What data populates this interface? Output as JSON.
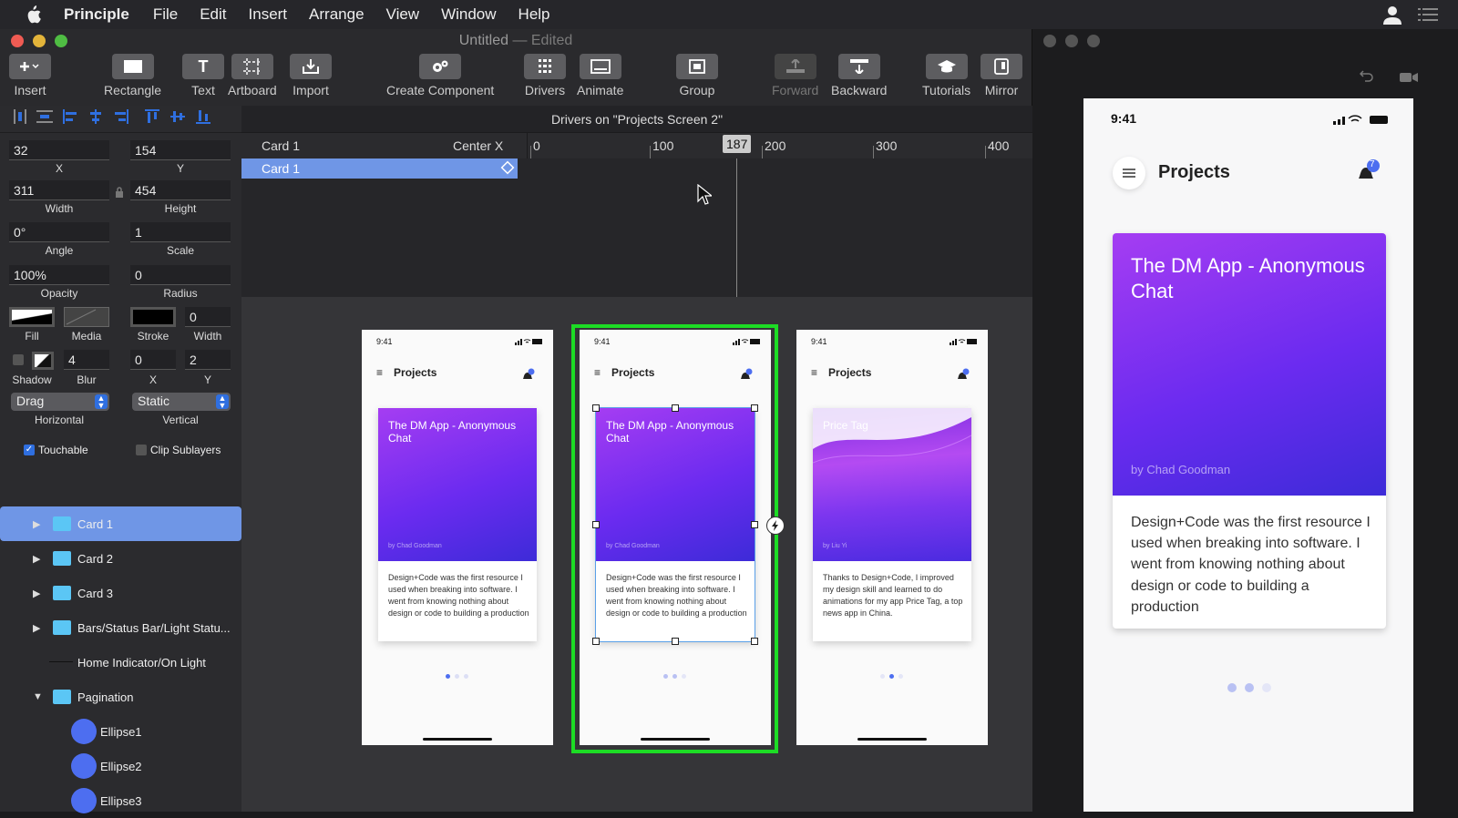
{
  "menubar": {
    "app": "Principle",
    "items": [
      "File",
      "Edit",
      "Insert",
      "Arrange",
      "View",
      "Window",
      "Help"
    ]
  },
  "window": {
    "title": "Untitled",
    "edited": "— Edited"
  },
  "toolbar": {
    "insert": "Insert",
    "rectangle": "Rectangle",
    "text": "Text",
    "artboard": "Artboard",
    "import": "Import",
    "create_component": "Create Component",
    "drivers": "Drivers",
    "animate": "Animate",
    "group": "Group",
    "forward": "Forward",
    "backward": "Backward",
    "tutorials": "Tutorials",
    "mirror": "Mirror"
  },
  "inspector": {
    "x": "32",
    "y": "154",
    "x_label": "X",
    "y_label": "Y",
    "width": "311",
    "height": "454",
    "width_label": "Width",
    "height_label": "Height",
    "angle": "0°",
    "scale": "1",
    "angle_label": "Angle",
    "scale_label": "Scale",
    "opacity": "100%",
    "radius": "0",
    "opacity_label": "Opacity",
    "radius_label": "Radius",
    "fill_label": "Fill",
    "media_label": "Media",
    "stroke_label": "Stroke",
    "stroke_width": "0",
    "stroke_width_label": "Width",
    "blur": "4",
    "shadow_x": "0",
    "shadow_y": "2",
    "shadow_label": "Shadow",
    "blur_label": "Blur",
    "sx_label": "X",
    "sy_label": "Y",
    "horizontal": "Drag",
    "vertical": "Static",
    "horizontal_label": "Horizontal",
    "vertical_label": "Vertical",
    "touchable": "Touchable",
    "clip": "Clip Sublayers"
  },
  "layers": [
    {
      "name": "Card 1",
      "type": "folder",
      "expanded": false,
      "selected": true
    },
    {
      "name": "Card 2",
      "type": "folder",
      "expanded": false
    },
    {
      "name": "Card 3",
      "type": "folder",
      "expanded": false
    },
    {
      "name": "Bars/Status Bar/Light Statu...",
      "type": "folder",
      "expanded": false
    },
    {
      "name": "Home Indicator/On Light",
      "type": "line"
    },
    {
      "name": "Pagination",
      "type": "folder",
      "expanded": true
    },
    {
      "name": "Ellipse1",
      "type": "ellipse"
    },
    {
      "name": "Ellipse2",
      "type": "ellipse"
    },
    {
      "name": "Ellipse3",
      "type": "ellipse"
    }
  ],
  "drivers": {
    "title": "Drivers on \"Projects Screen 2\"",
    "layer": "Card 1",
    "property": "Center X",
    "row": "Card 1",
    "current": "187",
    "ticks": [
      "0",
      "100",
      "200",
      "300",
      "400"
    ]
  },
  "screens": [
    {
      "time": "9:41",
      "header": "Projects",
      "card_title": "The DM App - Anonymous Chat",
      "by": "by Chad Goodman",
      "body": "Design+Code was the first resource I used when breaking into software. I went from knowing nothing about design or code to building a production"
    },
    {
      "time": "9:41",
      "header": "Projects",
      "card_title": "The DM App - Anonymous Chat",
      "by": "by Chad Goodman",
      "body": "Design+Code was the first resource I used when breaking into software. I went from knowing nothing about design or code to building a production"
    },
    {
      "time": "9:41",
      "header": "Projects",
      "card_title": "Price Tag",
      "by": "by Liu Yi",
      "body": "Thanks to Design+Code, I improved my design skill and learned to do animations for my app Price Tag, a top news app in China."
    }
  ],
  "preview": {
    "time": "9:41",
    "header": "Projects",
    "badge": "7",
    "card_title": "The DM App - Anonymous Chat",
    "by": "by Chad Goodman",
    "body": "Design+Code was the first resource I used when breaking into software. I went from knowing nothing about design or code to building a production"
  },
  "colors": {
    "accent": "#2f6fe0",
    "selection": "#6f96e6",
    "highlight": "#1ddc25",
    "folder": "#5bc6f5",
    "ellipse": "#4d6ef0",
    "card_gradient_start": "#a53df2",
    "card_gradient_end": "#3d2bd8"
  }
}
